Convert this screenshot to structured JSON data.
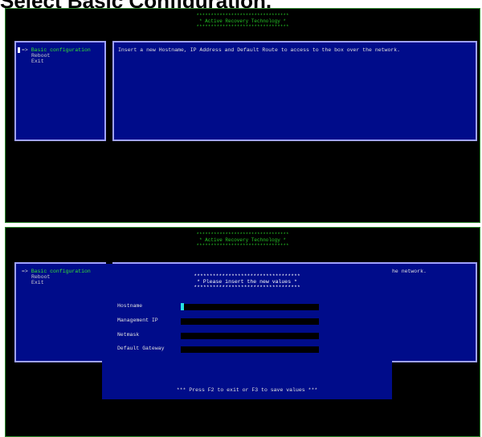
{
  "page_title": "Select Basic Configuration.",
  "banner": {
    "border": "********************************",
    "title": "* Active Recovery Technology *"
  },
  "menu": {
    "arrow": "=>",
    "items": [
      {
        "label": "Basic configuration"
      },
      {
        "label": "Reboot"
      },
      {
        "label": "Exit"
      }
    ]
  },
  "description": "Insert a new Hostname, IP Address and Default Route to access to the box over the network.",
  "description_tail": "he network.",
  "dialog": {
    "border": "**********************************",
    "title": "* Please insert the new values *",
    "fields": [
      {
        "label": "Hostname",
        "value": ""
      },
      {
        "label": "Management IP",
        "value": ""
      },
      {
        "label": "Netmask",
        "value": ""
      },
      {
        "label": "Default Gateway",
        "value": ""
      }
    ],
    "footer": "*** Press F2 to exit or F3 to save values ***"
  },
  "colors": {
    "screen_bg": "#000000",
    "panel_bg": "#000c8a",
    "panel_border": "#9fa2ff",
    "banner_text": "#26c826",
    "selected_text": "#34e034",
    "field_cursor": "#26e0e0"
  }
}
